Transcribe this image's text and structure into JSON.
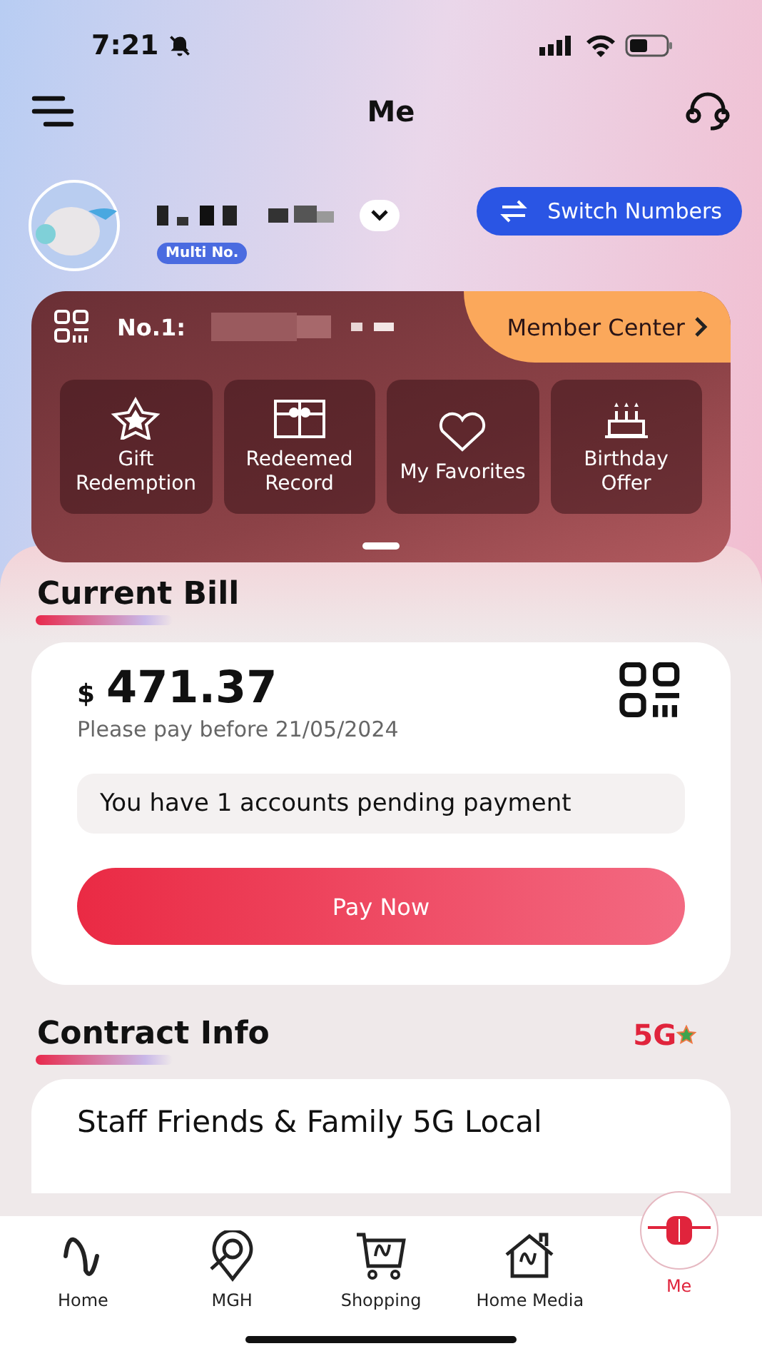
{
  "status_bar": {
    "time": "7:21"
  },
  "header": {
    "title": "Me"
  },
  "profile": {
    "badge": "Multi No.",
    "switch_button": "Switch Numbers"
  },
  "member_card": {
    "number_label": "No.1:",
    "link": "Member Center",
    "actions": [
      {
        "label": "Gift Redemption"
      },
      {
        "label": "Redeemed Record"
      },
      {
        "label": "My Favorites"
      },
      {
        "label": "Birthday Offer"
      }
    ]
  },
  "bill": {
    "title": "Current Bill",
    "currency": "$",
    "amount": "471.37",
    "due": "Please pay before 21/05/2024",
    "notice": "You have 1 accounts pending payment",
    "pay_button": "Pay Now"
  },
  "contract": {
    "title": "Contract Info",
    "logo": "5G",
    "plan": "Staff Friends & Family 5G Local"
  },
  "nav": [
    {
      "label": "Home",
      "selected": false
    },
    {
      "label": "MGH",
      "selected": false
    },
    {
      "label": "Shopping",
      "selected": false
    },
    {
      "label": "Home Media",
      "selected": false
    },
    {
      "label": "Me",
      "selected": true
    }
  ]
}
